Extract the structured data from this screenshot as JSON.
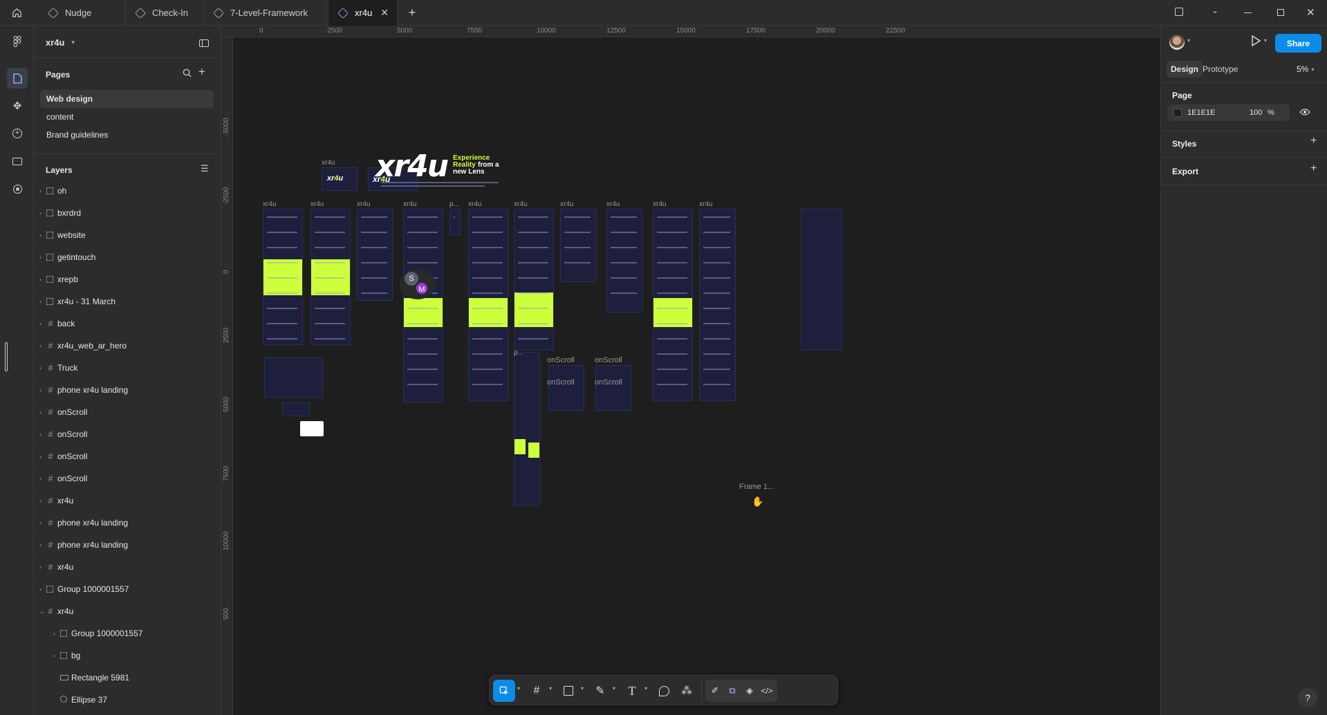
{
  "tabs": [
    {
      "label": "Nudge"
    },
    {
      "label": "Check-In"
    },
    {
      "label": "7-Level-Framework"
    },
    {
      "label": "xr4u",
      "active": true
    }
  ],
  "file": {
    "name": "xr4u"
  },
  "pages": {
    "title": "Pages",
    "items": [
      "Web design",
      "content",
      "Brand guidelines"
    ],
    "selected": "Web design"
  },
  "layers": {
    "title": "Layers",
    "items": [
      {
        "name": "oh",
        "icon": "group-icon"
      },
      {
        "name": "bxrdrd",
        "icon": "group-icon"
      },
      {
        "name": "website",
        "icon": "group-icon"
      },
      {
        "name": "getintouch",
        "icon": "group-icon"
      },
      {
        "name": "xrepb",
        "icon": "group-icon"
      },
      {
        "name": "xr4u - 31 March",
        "icon": "group-icon"
      },
      {
        "name": "back",
        "icon": "frame-icon"
      },
      {
        "name": "xr4u_web_ar_hero",
        "icon": "frame-icon"
      },
      {
        "name": "Truck",
        "icon": "frame-icon"
      },
      {
        "name": "phone xr4u landing",
        "icon": "frame-icon"
      },
      {
        "name": "onScroll",
        "icon": "frame-icon"
      },
      {
        "name": "onScroll",
        "icon": "frame-icon"
      },
      {
        "name": "onScroll",
        "icon": "frame-icon"
      },
      {
        "name": "onScroll",
        "icon": "frame-icon"
      },
      {
        "name": "xr4u",
        "icon": "frame-icon"
      },
      {
        "name": "phone xr4u landing",
        "icon": "frame-icon"
      },
      {
        "name": "phone xr4u landing",
        "icon": "frame-icon"
      },
      {
        "name": "xr4u",
        "icon": "frame-icon"
      },
      {
        "name": "Group 1000001557",
        "icon": "group-icon"
      },
      {
        "name": "xr4u",
        "icon": "frame-icon",
        "expanded": true
      },
      {
        "name": "Group 1000001557",
        "icon": "group-icon",
        "child": true
      },
      {
        "name": "bg",
        "icon": "group-icon",
        "child": true
      },
      {
        "name": "Rectangle 5981",
        "icon": "rectangle-icon",
        "child": true
      },
      {
        "name": "Ellipse 37",
        "icon": "ellipse-icon",
        "child": true
      }
    ]
  },
  "ruler": {
    "top": [
      "0",
      "2500",
      "5000",
      "7500",
      "10000",
      "12500",
      "15000",
      "17500",
      "20000",
      "22500"
    ],
    "left": [
      "-5000",
      "-2500",
      "0",
      "2500",
      "5000",
      "7500",
      "10000",
      "500"
    ]
  },
  "canvas": {
    "labels": {
      "xr4u": "xr4u",
      "p": "p...",
      "onScroll": "onScroll",
      "frame": "Frame 1..."
    },
    "hero": {
      "logo": "xr4u",
      "tagline_1": "Experience",
      "tagline_2": "Reality",
      "tagline_3": "from a",
      "tagline_4": "new Lens"
    },
    "avatars": [
      "S",
      "M"
    ]
  },
  "toolbar": {
    "tools": [
      "move-tool",
      "frame-tool",
      "shape-tool",
      "pen-tool",
      "text-tool",
      "comment-tool",
      "actions-tool",
      "draw-mode",
      "design-mode",
      "dev-mode-toggle",
      "code-tool"
    ]
  },
  "right_panel": {
    "share_label": "Share",
    "tab_design": "Design",
    "tab_prototype": "Prototype",
    "zoom": "5%",
    "page_section": "Page",
    "bg_color_hex": "1E1E1E",
    "bg_opacity": "100",
    "percent_sign": "%",
    "styles_section": "Styles",
    "export_section": "Export"
  },
  "help_label": "?",
  "colors": {
    "accent": "#0c8ce9",
    "lime": "#cdff3a",
    "frame_bg": "#1d1f3d",
    "avatar_s": "#5a5f6e",
    "avatar_m": "#9b3fe0"
  }
}
